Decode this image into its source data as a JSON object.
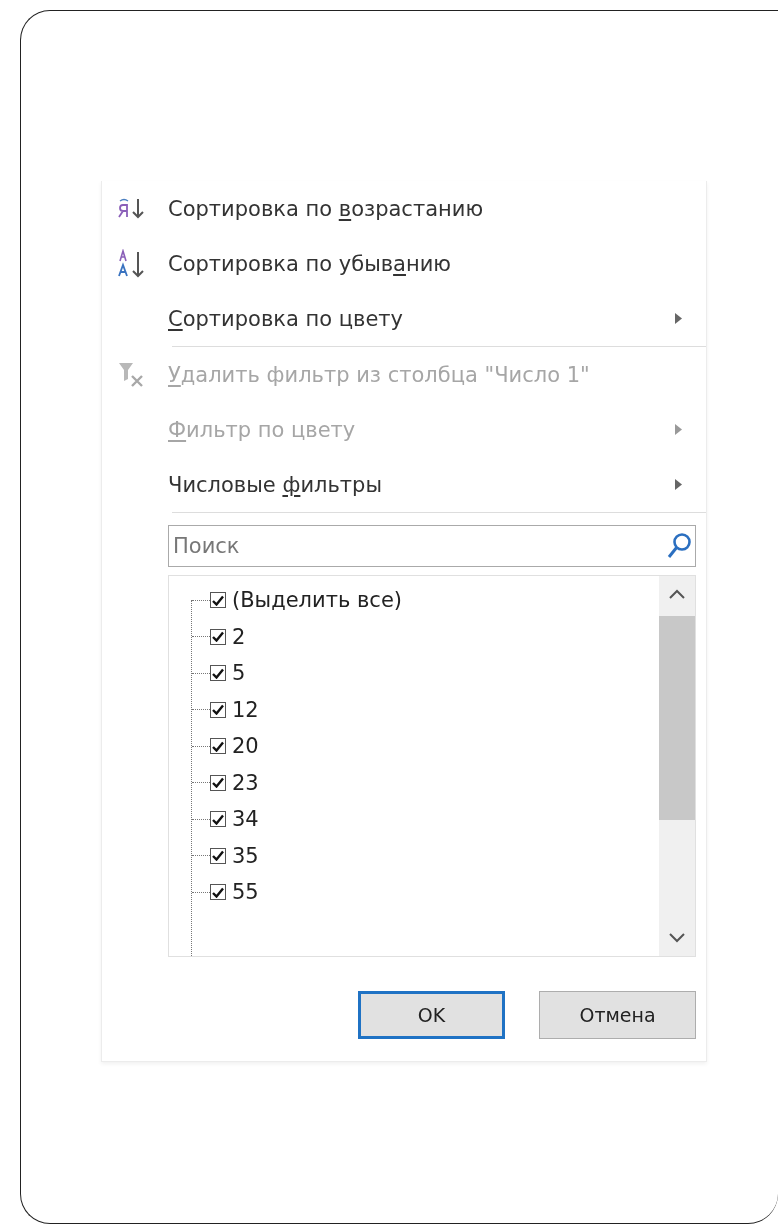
{
  "menu": {
    "groups": [
      [
        {
          "kind": "sort-ascending",
          "label": {
            "before": "Сортировка по ",
            "key": "в",
            "after": "озрастанию"
          },
          "disabled": false,
          "submenu": false
        },
        {
          "kind": "sort-descending",
          "label": {
            "before": "Сортировка по убыв",
            "key": "а",
            "after": "нию"
          },
          "disabled": false,
          "submenu": false
        },
        {
          "kind": "plain",
          "label": {
            "key": "С",
            "after": "ортировка по цвету"
          },
          "disabled": false,
          "submenu": true
        }
      ],
      [
        {
          "kind": "clear-filter",
          "label": {
            "key": "У",
            "after": "далить фильтр из столбца \"Число 1\""
          },
          "disabled": true,
          "submenu": false
        },
        {
          "kind": "plain",
          "label": {
            "key": "Ф",
            "after": "ильтр по цвету"
          },
          "disabled": true,
          "submenu": true
        },
        {
          "kind": "plain",
          "label": {
            "before": "Числовые ",
            "key": "ф",
            "after": "ильтры"
          },
          "disabled": false,
          "submenu": true
        }
      ]
    ]
  },
  "search": {
    "placeholder": "Поиск"
  },
  "values": [
    {
      "label": "(Выделить все)",
      "checked": true
    },
    {
      "label": "2",
      "checked": true
    },
    {
      "label": "5",
      "checked": true
    },
    {
      "label": "12",
      "checked": true
    },
    {
      "label": "20",
      "checked": true
    },
    {
      "label": "23",
      "checked": true
    },
    {
      "label": "34",
      "checked": true
    },
    {
      "label": "35",
      "checked": true
    },
    {
      "label": "55",
      "checked": true
    }
  ],
  "buttons": [
    {
      "label": "OK",
      "default": true
    },
    {
      "label": "Отмена",
      "default": false
    }
  ]
}
